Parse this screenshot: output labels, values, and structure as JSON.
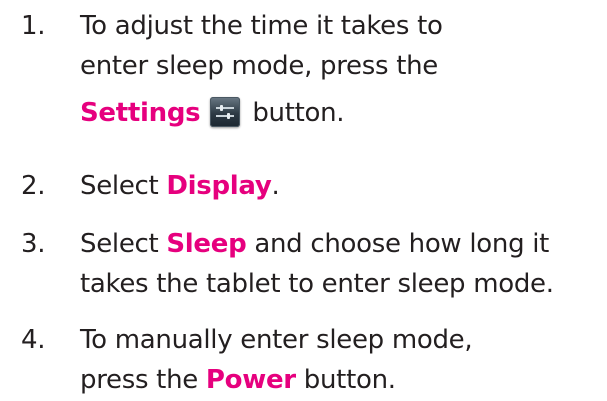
{
  "steps": [
    {
      "number": "1.",
      "line1": "To adjust the time it takes to",
      "line2": "enter sleep mode, press the",
      "line3_bold": "Settings",
      "line3_icon": "settings-icon",
      "line3_end": "button."
    },
    {
      "number": "2.",
      "pre": "Select ",
      "bold": "Display",
      "post": "."
    },
    {
      "number": "3.",
      "pre": "Select ",
      "bold": "Sleep",
      "post": " and choose how long it",
      "line2": "takes the tablet to enter sleep mode."
    },
    {
      "number": "4.",
      "line1": "To manually enter sleep mode,",
      "line2_pre": "press the ",
      "line2_bold": "Power",
      "line2_post": " button."
    }
  ],
  "colors": {
    "highlight": "#e6007e",
    "text": "#231f20"
  }
}
